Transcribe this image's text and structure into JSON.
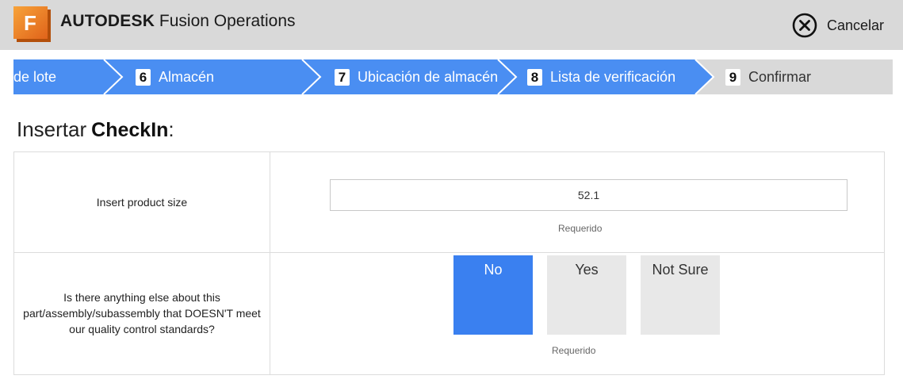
{
  "header": {
    "logo_letter": "F",
    "brand_bold": "AUTODESK",
    "brand_product": "Fusion Operations",
    "cancel_label": "Cancelar",
    "logo_color": "#e8701a"
  },
  "stepper": {
    "active_color": "#4a8ef2",
    "inactive_color": "#d9d9d9",
    "steps": [
      {
        "num": "",
        "label": "de lote",
        "state": "active"
      },
      {
        "num": "6",
        "label": "Almacén",
        "state": "active"
      },
      {
        "num": "7",
        "label": "Ubicación de almacén",
        "state": "active"
      },
      {
        "num": "8",
        "label": "Lista de verificación",
        "state": "active"
      },
      {
        "num": "9",
        "label": "Confirmar",
        "state": "inactive"
      }
    ]
  },
  "form": {
    "title_prefix": "Insertar",
    "title_name": "CheckIn",
    "title_suffix": ":",
    "rows": [
      {
        "question": "Insert product size",
        "value": "52.1",
        "required_label": "Requerido"
      },
      {
        "question": "Is there anything else about this part/assembly/subassembly that DOESN'T meet our quality control standards?",
        "options": [
          "No",
          "Yes",
          "Not Sure"
        ],
        "selected": "No",
        "required_label": "Requerido"
      }
    ]
  }
}
